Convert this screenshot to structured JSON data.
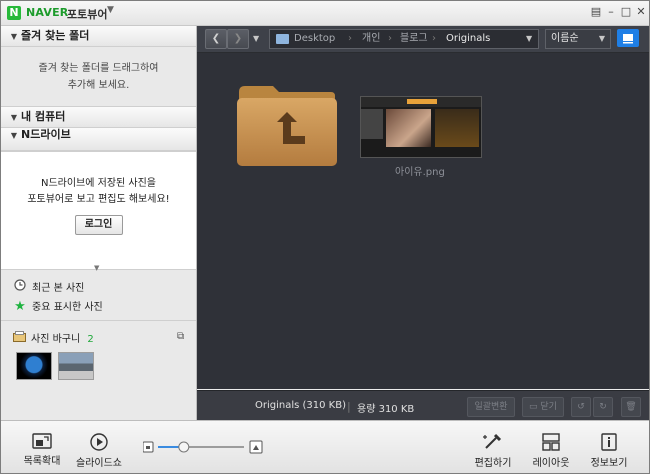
{
  "titlebar": {
    "brand": "NAVER",
    "app_name": "포토뷰어",
    "logo_icon": "naver-logo-icon"
  },
  "left_panel": {
    "favorites": {
      "header": "즐겨 찾는 폴더",
      "empty_line1": "즐겨 찾는 폴더를 드래그하여",
      "empty_line2": "추가해 보세요."
    },
    "my_computer": {
      "header": "내 컴퓨터"
    },
    "ndrive": {
      "header": "N드라이브",
      "line1": "N드라이브에 저장된 사진을",
      "line2": "포토뷰어로 보고 편집도 해보세요!",
      "login_label": "로그인"
    },
    "recent_label": "최근 본 사진",
    "starred_label": "중요 표시한 사진",
    "basket": {
      "label": "사진 바구니",
      "count": "2"
    }
  },
  "nav": {
    "path": [
      "Desktop",
      "개인",
      "블로그",
      "Originals"
    ],
    "sort_label": "이름순"
  },
  "content": {
    "items": [
      {
        "type": "folder-up",
        "name": ""
      },
      {
        "type": "image",
        "name": "아이유.png"
      }
    ]
  },
  "status": {
    "folder_info": "Originals (310 KB)",
    "size_info": "용량 310 KB",
    "batch_convert": "일괄변환",
    "close_label": "닫기"
  },
  "toolbar": {
    "enlarge_list": "목록확대",
    "slideshow": "슬라이드쇼",
    "edit": "편집하기",
    "layout": "레이아웃",
    "info": "정보보기",
    "zoom_level": 0.3
  },
  "colors": {
    "brand_green": "#1c9b2b",
    "accent_blue": "#1f7fe6",
    "content_bg": "#2f3138"
  }
}
